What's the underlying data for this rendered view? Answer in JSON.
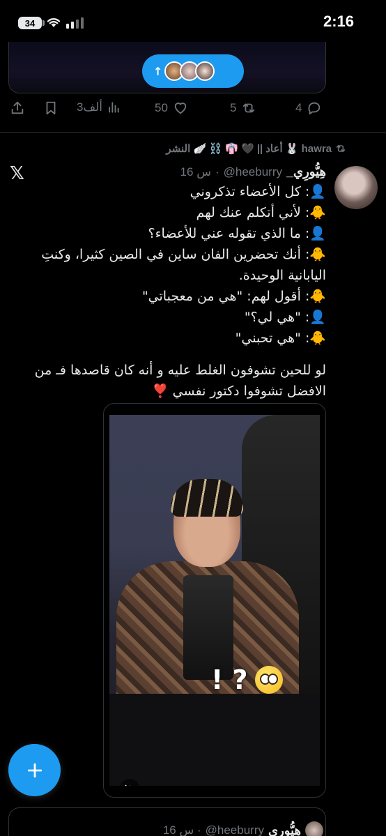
{
  "status_bar": {
    "battery": "34",
    "time": "2:16"
  },
  "prev_tweet": {
    "new_posts_arrow": "↑",
    "stats": {
      "views": "3ألف",
      "likes": "50",
      "reposts": "5",
      "replies": "4"
    }
  },
  "tweet": {
    "reposted_by": "hawra 🐰 أعاد",
    "reposted_by_extra": "|| 🖤 👘 ⛓️ 🪽 النشر",
    "display_name": "هِيُّورِي_",
    "handle": "@heeburry",
    "time": "16 س",
    "lines": [
      "👤: كل الأعضاء تذكروني",
      "🐥: لأني أتكلم عنك لهم",
      "👤: ما الذي تقوله عني للأعضاء؟",
      "🐥: أنك تحضرين الفان ساين في الصين كثيرا، وكنتِ اليابانية الوحيدة.",
      "🐥: أقول لهم: \"هي من معجباتي\"",
      "👤: \"هي لي؟\"",
      "🐥: \"هي تحبني\""
    ],
    "closing": "لو للحين تشوفون الغلط عليه و أنه كان قاصدها فـ من الافضل تشوفوا دكتور نفسي ❣️",
    "video_overlay": "! ?"
  },
  "quoted": {
    "display_name": "هِيُّوري",
    "handle": "@heeburry",
    "time": "16 س ·"
  },
  "icons": [
    "share-icon",
    "bookmark-icon",
    "views-icon",
    "like-icon",
    "repost-icon",
    "reply-icon",
    "x-logo-icon",
    "mute-icon",
    "compose-icon"
  ],
  "colors": {
    "accent": "#1d9bf0",
    "muted": "#71767b",
    "text": "#e7e9ea",
    "border": "#2f3336"
  }
}
